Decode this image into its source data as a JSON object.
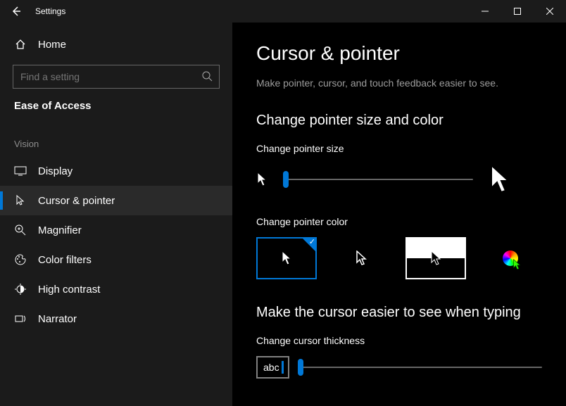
{
  "window": {
    "title": "Settings"
  },
  "sidebar": {
    "home": "Home",
    "search_placeholder": "Find a setting",
    "category": "Ease of Access",
    "group": "Vision",
    "items": [
      {
        "label": "Display"
      },
      {
        "label": "Cursor & pointer"
      },
      {
        "label": "Magnifier"
      },
      {
        "label": "Color filters"
      },
      {
        "label": "High contrast"
      },
      {
        "label": "Narrator"
      }
    ]
  },
  "page": {
    "title": "Cursor & pointer",
    "description": "Make pointer, cursor, and touch feedback easier to see.",
    "section1_head": "Change pointer size and color",
    "size_label": "Change pointer size",
    "color_label": "Change pointer color",
    "section2_head": "Make the cursor easier to see when typing",
    "thickness_label": "Change cursor thickness",
    "abc_sample": "abc"
  }
}
